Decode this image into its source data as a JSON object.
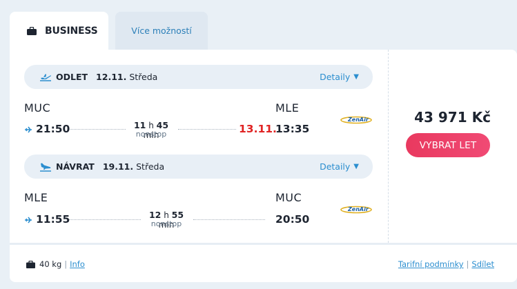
{
  "tabs": [
    {
      "label": "BUSINESS",
      "icon": "briefcase-icon",
      "active": true
    },
    {
      "label": "Více možností",
      "active": false
    }
  ],
  "outbound": {
    "direction": "ODLET",
    "date": "12.11.",
    "day": "Středa",
    "detail_label": "Detaily",
    "from_code": "MUC",
    "to_code": "MLE",
    "dep_time": "21:50",
    "arr_time": "13:35",
    "arr_date": "13.11.",
    "duration_h": "11",
    "duration_h_unit": "h",
    "duration_m": "45",
    "duration_m_unit": "min",
    "stops": "nonstop",
    "airline_logo": "ZenAir"
  },
  "return": {
    "direction": "NÁVRAT",
    "date": "19.11.",
    "day": "Středa",
    "detail_label": "Detaily",
    "from_code": "MLE",
    "to_code": "MUC",
    "dep_time": "11:55",
    "arr_time": "20:50",
    "duration_h": "12",
    "duration_h_unit": "h",
    "duration_m": "55",
    "duration_m_unit": "min",
    "stops": "nonstop",
    "airline_logo": "ZenAir"
  },
  "price": "43 971 Kč",
  "select_button": "VYBRAT LET",
  "footer": {
    "baggage": "40 kg",
    "info_link": "Info",
    "fare_link": "Tarifní podmínky",
    "share_link": "Sdílet",
    "separator": "|"
  },
  "colors": {
    "accent": "#2b8ecf",
    "button": "#ee4069",
    "date_change": "#e02323",
    "background": "#e9f0f6"
  }
}
